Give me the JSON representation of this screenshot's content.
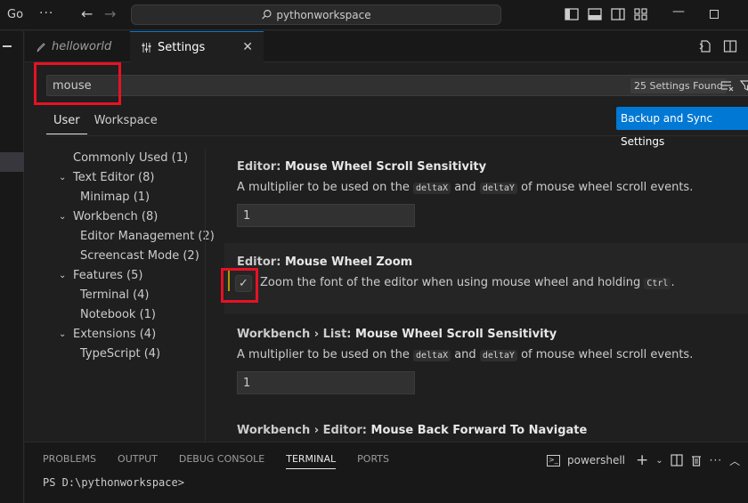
{
  "titlebar": {
    "menu_go": "Go",
    "more": "···",
    "back_icon": "arrow-left-icon",
    "forward_icon": "arrow-right-icon",
    "search_text": "pythonworkspace",
    "minimize": "—"
  },
  "tabs": {
    "items": [
      {
        "label": "helloworld",
        "icon": "file-icon"
      },
      {
        "label": "Settings",
        "icon": "settings-sliders-icon"
      }
    ],
    "close": "✕"
  },
  "search": {
    "value": "mouse",
    "results_badge": "25 Settings Found"
  },
  "scope": {
    "user": "User",
    "workspace": "Workspace",
    "sync_button": "Backup and Sync Settings"
  },
  "toc": [
    {
      "label": "Commonly Used (1)",
      "depth": 0,
      "expandable": false
    },
    {
      "label": "Text Editor (8)",
      "depth": 0,
      "expandable": true
    },
    {
      "label": "Minimap (1)",
      "depth": 1,
      "expandable": false
    },
    {
      "label": "Workbench (8)",
      "depth": 0,
      "expandable": true
    },
    {
      "label": "Editor Management (2)",
      "depth": 1,
      "expandable": false
    },
    {
      "label": "Screencast Mode (2)",
      "depth": 1,
      "expandable": false
    },
    {
      "label": "Features (5)",
      "depth": 0,
      "expandable": true
    },
    {
      "label": "Terminal (4)",
      "depth": 1,
      "expandable": false
    },
    {
      "label": "Notebook (1)",
      "depth": 1,
      "expandable": false
    },
    {
      "label": "Extensions (4)",
      "depth": 0,
      "expandable": true
    },
    {
      "label": "TypeScript (4)",
      "depth": 1,
      "expandable": false
    }
  ],
  "settings": {
    "s1": {
      "category": "Editor: ",
      "name": "Mouse Wheel Scroll Sensitivity",
      "desc_pre": "A multiplier to be used on the ",
      "code1": "deltaX",
      "desc_mid": " and ",
      "code2": "deltaY",
      "desc_post": " of mouse wheel scroll events.",
      "value": "1"
    },
    "s2": {
      "category": "Editor: ",
      "name": "Mouse Wheel Zoom",
      "desc_pre": "Zoom the font of the editor when using mouse wheel and holding ",
      "code1": "Ctrl",
      "desc_post": ".",
      "checked": true,
      "check_glyph": "✓"
    },
    "s3": {
      "category": "Workbench › List: ",
      "name": "Mouse Wheel Scroll Sensitivity",
      "desc_pre": "A multiplier to be used on the ",
      "code1": "deltaX",
      "desc_mid": " and ",
      "code2": "deltaY",
      "desc_post": " of mouse wheel scroll events.",
      "value": "1"
    },
    "s4": {
      "category": "Workbench › Editor: ",
      "name": "Mouse Back Forward To Navigate"
    }
  },
  "panel": {
    "tabs": [
      "PROBLEMS",
      "OUTPUT",
      "DEBUG CONSOLE",
      "TERMINAL",
      "PORTS"
    ],
    "active_tab": "TERMINAL",
    "shell": "powershell",
    "prompt": "PS D:\\pythonworkspace>"
  },
  "colors": {
    "accent": "#0078d4",
    "highlight_box": "#e81123",
    "modified_indicator": "#b89500"
  }
}
